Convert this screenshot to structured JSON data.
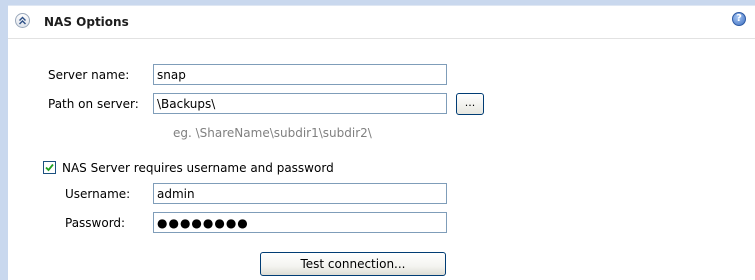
{
  "panel": {
    "title": "NAS Options",
    "help_icon_glyph": "?"
  },
  "server_name": {
    "label": "Server name:",
    "value": "snap"
  },
  "path": {
    "label": "Path on server:",
    "value": "\\Backups\\",
    "browse_label": "...",
    "hint": "eg. \\ShareName\\subdir1\\subdir2\\"
  },
  "credentials": {
    "checkbox_label": "NAS Server requires username and password",
    "checked": true,
    "username_label": "Username:",
    "username_value": "admin",
    "password_label": "Password:",
    "password_value": "●●●●●●●●"
  },
  "test_button_label": "Test connection...",
  "icons": {
    "collapse": "chevron-double-up-icon",
    "help": "help-icon",
    "check": "checkmark-icon"
  },
  "colors": {
    "background": "#c9d8ee",
    "field_border": "#7f9db9",
    "button_border": "#003c74",
    "hint_text": "#808080"
  }
}
